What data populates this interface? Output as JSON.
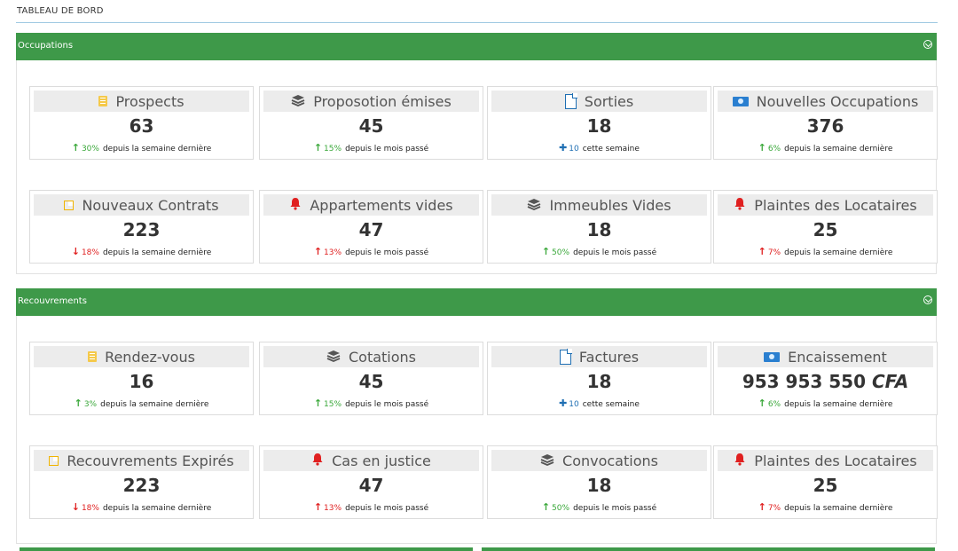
{
  "page": {
    "title": "TABLEAU DE BORD"
  },
  "colors": {
    "panel_header": "#3e9949",
    "up": "#3aa83a",
    "down": "#e02020",
    "plus": "#1f6fb3"
  },
  "sections": [
    {
      "title": "Occupations",
      "cards": [
        {
          "label": "Prospects",
          "icon": "folder-icon",
          "value": "63",
          "trend": "up",
          "trend_color": "green",
          "pct": "30%",
          "note": "depuis la semaine dernière"
        },
        {
          "label": "Proposotion émises",
          "icon": "layers-icon",
          "value": "45",
          "trend": "up",
          "trend_color": "green",
          "pct": "15%",
          "note": "depuis le mois passé"
        },
        {
          "label": "Sorties",
          "icon": "document-icon",
          "value": "18",
          "trend": "plus",
          "trend_color": "blue",
          "pct": "10",
          "note": "cette semaine"
        },
        {
          "label": "Nouvelles Occupations",
          "icon": "money-icon",
          "value": "376",
          "trend": "up",
          "trend_color": "green",
          "pct": "6%",
          "note": "depuis la semaine dernière"
        },
        {
          "label": "Nouveaux Contrats",
          "icon": "edit-icon",
          "value": "223",
          "trend": "down",
          "trend_color": "red",
          "pct": "18%",
          "note": "depuis la semaine dernière"
        },
        {
          "label": "Appartements vides",
          "icon": "bell-icon",
          "value": "47",
          "trend": "up",
          "trend_color": "red",
          "pct": "13%",
          "note": "depuis le mois passé"
        },
        {
          "label": "Immeubles Vides",
          "icon": "layers-icon",
          "value": "18",
          "trend": "up",
          "trend_color": "green",
          "pct": "50%",
          "note": "depuis le mois passé"
        },
        {
          "label": "Plaintes des Locataires",
          "icon": "bell-icon",
          "value": "25",
          "trend": "up",
          "trend_color": "red",
          "pct": "7%",
          "note": "depuis la semaine dernière"
        }
      ]
    },
    {
      "title": "Recouvrements",
      "cards": [
        {
          "label": "Rendez-vous",
          "icon": "folder-icon",
          "value": "16",
          "trend": "up",
          "trend_color": "green",
          "pct": "3%",
          "note": "depuis la semaine dernière"
        },
        {
          "label": "Cotations",
          "icon": "layers-icon",
          "value": "45",
          "trend": "up",
          "trend_color": "green",
          "pct": "15%",
          "note": "depuis le mois passé"
        },
        {
          "label": "Factures",
          "icon": "document-icon",
          "value": "18",
          "trend": "plus",
          "trend_color": "blue",
          "pct": "10",
          "note": "cette semaine"
        },
        {
          "label": "Encaissement",
          "icon": "money-icon",
          "value": "953 953 550",
          "unit": "CFA",
          "trend": "up",
          "trend_color": "green",
          "pct": "6%",
          "note": "depuis la semaine dernière"
        },
        {
          "label": "Recouvrements Expirés",
          "icon": "edit-icon",
          "value": "223",
          "trend": "down",
          "trend_color": "red",
          "pct": "18%",
          "note": "depuis la semaine dernière"
        },
        {
          "label": "Cas en justice",
          "icon": "bell-icon",
          "value": "47",
          "trend": "up",
          "trend_color": "red",
          "pct": "13%",
          "note": "depuis le mois passé"
        },
        {
          "label": "Convocations",
          "icon": "layers-icon",
          "value": "18",
          "trend": "up",
          "trend_color": "green",
          "pct": "50%",
          "note": "depuis le mois passé"
        },
        {
          "label": "Plaintes des Locataires",
          "icon": "bell-icon",
          "value": "25",
          "trend": "up",
          "trend_color": "red",
          "pct": "7%",
          "note": "depuis la semaine dernière"
        }
      ]
    }
  ]
}
